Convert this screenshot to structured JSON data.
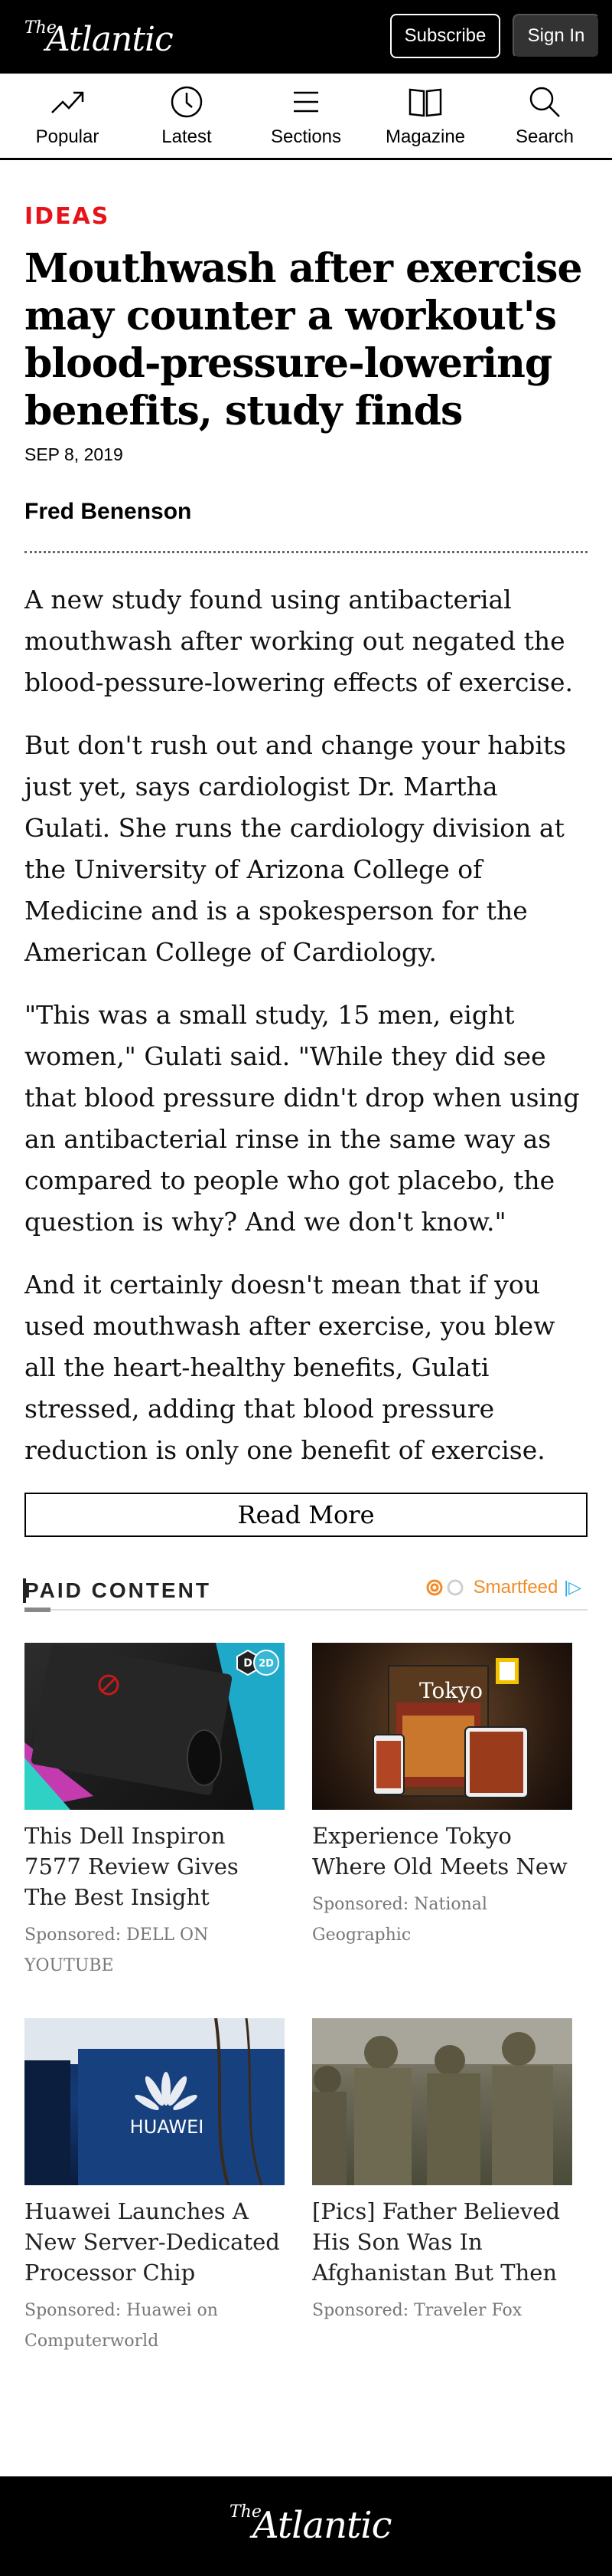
{
  "header": {
    "logo_the": "The",
    "logo_name": "Atlantic",
    "subscribe_label": "Subscribe",
    "signin_label": "Sign In"
  },
  "nav": {
    "items": [
      {
        "label": "Popular",
        "icon": "trending-up-icon"
      },
      {
        "label": "Latest",
        "icon": "clock-icon"
      },
      {
        "label": "Sections",
        "icon": "menu-icon"
      },
      {
        "label": "Magazine",
        "icon": "book-icon"
      },
      {
        "label": "Search",
        "icon": "search-icon"
      }
    ]
  },
  "article": {
    "kicker": "IDEAS",
    "headline": "Mouthwash after exercise may counter a workout's blood-pressure-lowering benefits, study finds",
    "date": "SEP 8, 2019",
    "author": "Fred Benenson",
    "paragraphs": [
      "A new study found using antibacterial mouthwash after working out negated the blood-pessure-lowering effects of exercise.",
      "But don't rush out and change your habits just yet, says cardiologist Dr. Martha Gulati. She runs the cardiology division at the University of Arizona College of Medicine and is a spokesperson for the American College of Cardiology.",
      "\"This was a small study, 15 men, eight women,\" Gulati said. \"While they did see that blood pressure didn't drop when using an antibacterial rinse in the same way as compared to people who got placebo, the question is why? And we don't know.\"",
      "And it certainly doesn't mean that if you used mouthwash after exercise, you blew all the heart-healthy benefits, Gulati stressed, adding that blood pressure reduction is only one benefit of exercise."
    ],
    "read_more_label": "Read More"
  },
  "paid": {
    "title": "PAID CONTENT",
    "provider": "Smartfeed",
    "tiles": [
      {
        "title": "This Dell Inspiron 7577 Review Gives The Best Insight",
        "sponsor": "Sponsored: DELL ON YOUTUBE",
        "badge": "2D"
      },
      {
        "title": "Experience Tokyo Where Old Meets New",
        "sponsor": "Sponsored: National Geographic",
        "badge": "Tokyo"
      },
      {
        "title": "Huawei Launches A New Server-Dedicated Processor Chip",
        "sponsor": "Sponsored: Huawei on Computerworld",
        "badge": "HUAWEI"
      },
      {
        "title": "[Pics] Father Believed His Son Was In Afghanistan But Then",
        "sponsor": "Sponsored: Traveler Fox",
        "badge": ""
      }
    ]
  },
  "footer": {
    "logo_the": "The",
    "logo_name": "Atlantic"
  },
  "colors": {
    "kicker": "#e7131a",
    "header_bg": "#000000",
    "signin_bg": "#333333",
    "smartfeed": "#f28c28"
  }
}
